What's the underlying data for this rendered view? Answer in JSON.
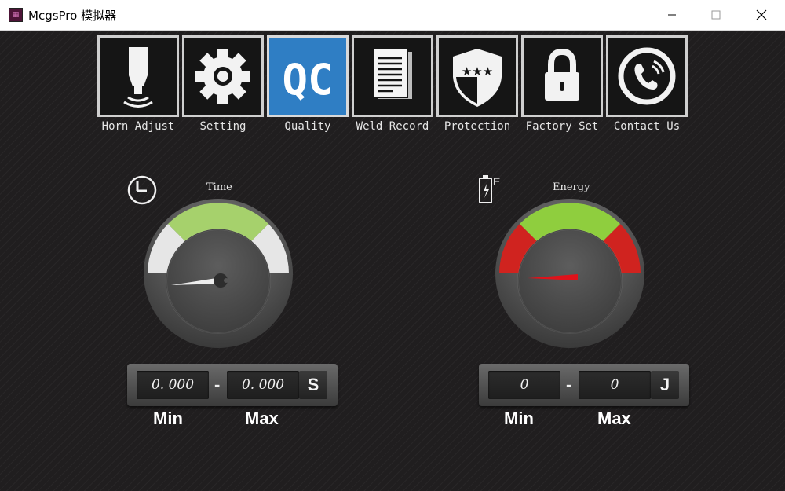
{
  "window": {
    "title": "McgsPro 模拟器",
    "icon": "mcgs-app-icon"
  },
  "nav": {
    "items": [
      {
        "label": "Horn Adjust",
        "icon": "horn-icon",
        "active": false
      },
      {
        "label": "Setting",
        "icon": "gear-icon",
        "active": false
      },
      {
        "label": "Quality",
        "icon": "qc-icon",
        "tile_text": "QC",
        "active": true
      },
      {
        "label": "Weld Record",
        "icon": "document-icon",
        "active": false
      },
      {
        "label": "Protection",
        "icon": "shield-icon",
        "active": false
      },
      {
        "label": "Factory Set",
        "icon": "lock-icon",
        "active": false
      },
      {
        "label": "Contact Us",
        "icon": "phone-icon",
        "active": false
      }
    ]
  },
  "time_gauge": {
    "title": "Time",
    "icon": "clock-icon",
    "min": "0. 000",
    "max": "0. 000",
    "unit": "S",
    "min_label": "Min",
    "max_label": "Max",
    "colors": {
      "ok": "#a6d16c",
      "zone": "#e6e6e6"
    }
  },
  "energy_gauge": {
    "title": "Energy",
    "icon": "battery-energy-icon",
    "icon_letter": "E",
    "min": "0",
    "max": "0",
    "unit": "J",
    "min_label": "Min",
    "max_label": "Max",
    "colors": {
      "ok": "#8fce3e",
      "bad": "#d0231f",
      "needle": "#e0121a"
    }
  }
}
